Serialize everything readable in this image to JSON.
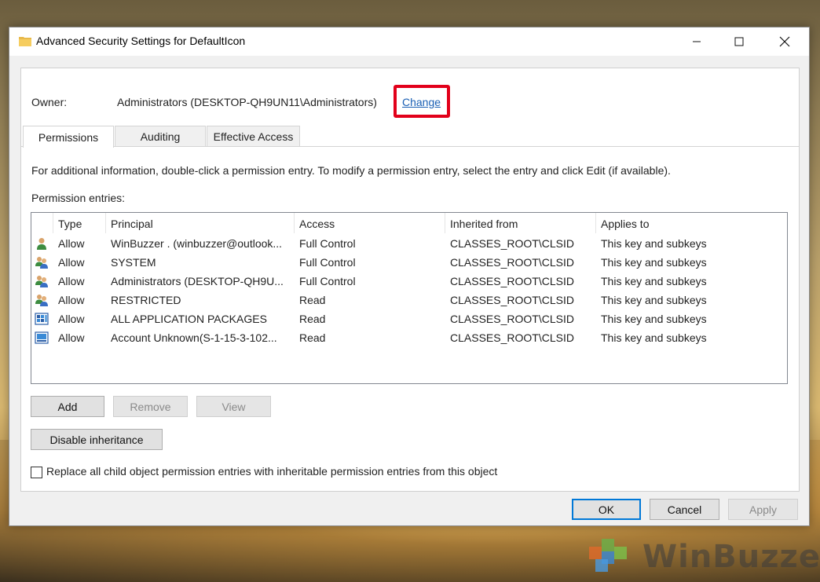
{
  "window": {
    "title": "Advanced Security Settings for DefaultIcon",
    "controls": [
      "minimize",
      "maximize",
      "close"
    ]
  },
  "owner": {
    "label": "Owner:",
    "value": "Administrators (DESKTOP-QH9UN11\\Administrators)",
    "change_link": "Change"
  },
  "tabs": [
    {
      "label": "Permissions",
      "active": true
    },
    {
      "label": "Auditing",
      "active": false
    },
    {
      "label": "Effective Access",
      "active": false
    }
  ],
  "info_text": "For additional information, double-click a permission entry. To modify a permission entry, select the entry and click Edit (if available).",
  "entries_label": "Permission entries:",
  "table": {
    "columns": [
      "Type",
      "Principal",
      "Access",
      "Inherited from",
      "Applies to"
    ],
    "rows": [
      {
        "icon": "user-icon",
        "type": "Allow",
        "principal": "WinBuzzer . (winbuzzer@outlook...",
        "access": "Full Control",
        "inherited_from": "CLASSES_ROOT\\CLSID",
        "applies_to": "This key and subkeys"
      },
      {
        "icon": "group-icon",
        "type": "Allow",
        "principal": "SYSTEM",
        "access": "Full Control",
        "inherited_from": "CLASSES_ROOT\\CLSID",
        "applies_to": "This key and subkeys"
      },
      {
        "icon": "group-icon",
        "type": "Allow",
        "principal": "Administrators (DESKTOP-QH9U...",
        "access": "Full Control",
        "inherited_from": "CLASSES_ROOT\\CLSID",
        "applies_to": "This key and subkeys"
      },
      {
        "icon": "group-icon",
        "type": "Allow",
        "principal": "RESTRICTED",
        "access": "Read",
        "inherited_from": "CLASSES_ROOT\\CLSID",
        "applies_to": "This key and subkeys"
      },
      {
        "icon": "app-packages-icon",
        "type": "Allow",
        "principal": "ALL APPLICATION PACKAGES",
        "access": "Read",
        "inherited_from": "CLASSES_ROOT\\CLSID",
        "applies_to": "This key and subkeys"
      },
      {
        "icon": "unknown-account-icon",
        "type": "Allow",
        "principal": "Account Unknown(S-1-15-3-102...",
        "access": "Read",
        "inherited_from": "CLASSES_ROOT\\CLSID",
        "applies_to": "This key and subkeys"
      }
    ]
  },
  "buttons": {
    "add": "Add",
    "remove": "Remove",
    "view": "View",
    "disable_inheritance": "Disable inheritance",
    "ok": "OK",
    "cancel": "Cancel",
    "apply": "Apply"
  },
  "replace_checkbox": {
    "label": "Replace all child object permission entries with inheritable permission entries from this object",
    "checked": false
  },
  "watermark": {
    "text": "WinBuzzer"
  },
  "colors": {
    "link": "#1a5fb4",
    "highlight": "#e2001a",
    "default_button_border": "#0078d7"
  }
}
